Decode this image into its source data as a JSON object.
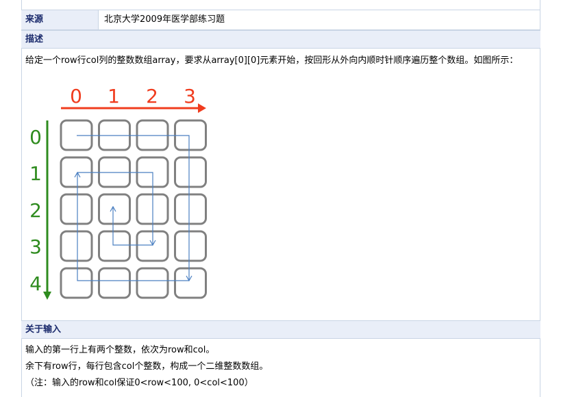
{
  "source": {
    "label": "来源",
    "value": "北京大学2009年医学部练习题"
  },
  "description": {
    "heading": "描述",
    "text": "给定一个row行col列的整数数组array，要求从array[0][0]元素开始，按回形从外向内顺时针顺序遍历整个数组。如图所示："
  },
  "figure": {
    "col_labels": [
      "0",
      "1",
      "2",
      "3"
    ],
    "row_labels": [
      "0",
      "1",
      "2",
      "3",
      "4"
    ],
    "col_color": "#f03c1e",
    "row_color": "#2e8b1e",
    "cell_border": "#808080",
    "path_color": "#4a7fc1"
  },
  "input": {
    "heading": "关于输入",
    "lines": [
      "输入的第一行上有两个整数，依次为row和col。",
      "余下有row行，每行包含col个整数，构成一个二维整数数组。",
      "（注：输入的row和col保证0<row<100, 0<col<100）"
    ]
  }
}
